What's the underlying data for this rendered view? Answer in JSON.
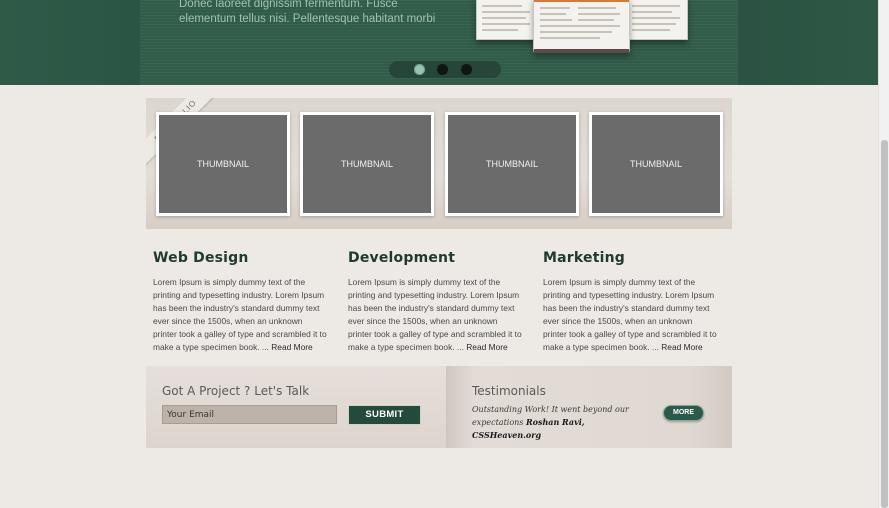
{
  "hero": {
    "text": "Donec laoreet dignissim fermentum. Fusce elementum tellus nisi. Pellentesque habitant morbi",
    "slider_dots": 3,
    "active_dot": 0
  },
  "portfolio": {
    "ribbon_label": "Portfolio",
    "thumbnails": [
      "THUMBNAIL",
      "THUMBNAIL",
      "THUMBNAIL",
      "THUMBNAIL"
    ]
  },
  "services": [
    {
      "title": "Web Design",
      "body": "Lorem Ipsum is simply dummy text of the printing and typesetting industry. Lorem Ipsum has been the industry's standard dummy text ever since the 1500s, when an unknown printer took a galley of type and scrambled it to make a type specimen book. ... ",
      "link": "Read More"
    },
    {
      "title": "Development",
      "body": "Lorem Ipsum is simply dummy text of the printing and typesetting industry. Lorem Ipsum has been the industry's standard dummy text ever since the 1500s, when an unknown printer took a galley of type and scrambled it to make a type specimen book. ... ",
      "link": "Read More"
    },
    {
      "title": "Marketing",
      "body": "Lorem Ipsum is simply dummy text of the printing and typesetting industry. Lorem Ipsum has been the industry's standard dummy text ever since the 1500s, when an unknown printer took a galley of type and scrambled it to make a type specimen book. ... ",
      "link": "Read More"
    }
  ],
  "contact": {
    "title": "Got A Project ? Let's Talk",
    "email_value": "Your Email",
    "submit_label": "SUBMIT"
  },
  "testimonials": {
    "title": "Testimonials",
    "quote": "Outstanding Work! It went beyond our expectations ",
    "author": "Roshan Ravi, CSSHeaven.org",
    "more_label": "MORE"
  },
  "colors": {
    "hero_green": "#335f4c",
    "accent_dark_green": "#234a3a",
    "page_background": "#ede9e4"
  }
}
